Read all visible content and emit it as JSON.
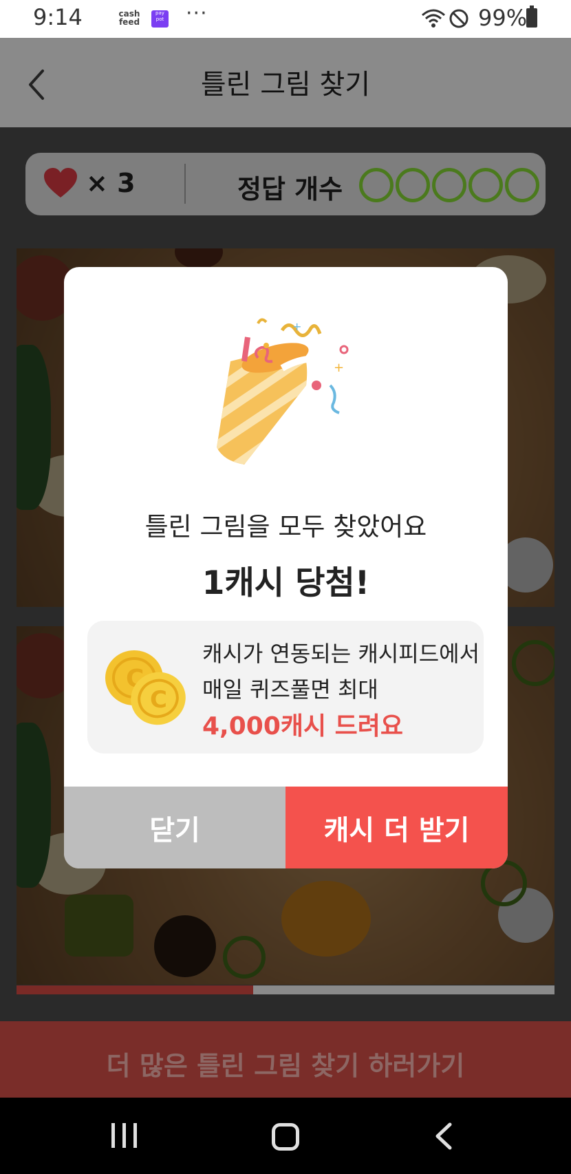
{
  "status_bar": {
    "time": "9:14",
    "app_icon_1": "cash feed",
    "app_icon_2": "pay pot",
    "more": "···",
    "battery": "99%",
    "icons": [
      "wifi-icon",
      "do-not-disturb-icon",
      "battery-icon"
    ]
  },
  "header": {
    "title": "틀린 그림 찾기",
    "back_icon": "chevron-left-icon"
  },
  "score": {
    "lives_label": "× 3",
    "lives_icon": "heart-icon",
    "answer_label": "정답 개수",
    "answer_circles": 5,
    "circle_color": "#4b7a1d"
  },
  "progress": {
    "fraction": 0.44
  },
  "modal": {
    "message": "틀린 그림을 모두 찾았어요",
    "prize": "1캐시 당첨!",
    "promo_line1": "캐시가 연동되는 캐시피드에서",
    "promo_line2": "매일 퀴즈풀면 최대",
    "promo_highlight": "4,000캐시 드려요",
    "close_button": "닫기",
    "more_button": "캐시 더 받기",
    "accent_color": "#f4524d",
    "party_icon": "party-popper-icon",
    "coin_icon": "coins-icon"
  },
  "cta": {
    "label": "더 많은 틀린 그림 찾기 하러가기"
  },
  "navbar": {
    "recent_icon": "recent-apps-icon",
    "home_icon": "home-icon",
    "back_icon": "back-icon"
  }
}
